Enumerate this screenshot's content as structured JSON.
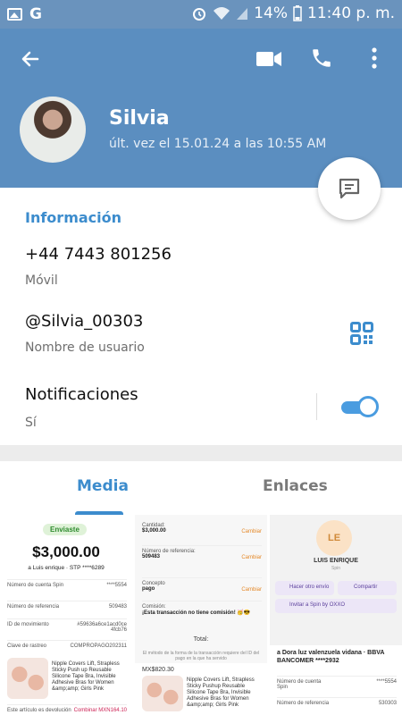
{
  "status_bar": {
    "battery": "14%",
    "time": "11:40 p. m."
  },
  "profile": {
    "name": "Silvia",
    "last_seen": "últ. vez el 15.01.24 a las 10:55 AM"
  },
  "info": {
    "section_title": "Información",
    "phone": "+44 7443 801256",
    "phone_label": "Móvil",
    "username": "@Silvia_00303",
    "username_label": "Nombre de usuario",
    "notifications_title": "Notificaciones",
    "notifications_value": "Sí"
  },
  "tabs": {
    "media": "Media",
    "links": "Enlaces"
  },
  "media": {
    "c1": {
      "badge": "Enviaste",
      "amount": "$3,000.00",
      "to": "a Luis enrique · STP ****6289",
      "rows": [
        {
          "k": "Número de cuenta Spin",
          "v": "****5554"
        },
        {
          "k": "Número de referencia",
          "v": "509483"
        },
        {
          "k": "ID de movimiento",
          "v": "#59636a6ce1acd0ce 4fcb76"
        },
        {
          "k": "Clave de rastreo",
          "v": "COMPROPAGO202311"
        }
      ],
      "ad_text": "Nipple Covers Lift, Strapless Sticky Push up Reusable Silicone Tape Bra, Invisible Adhesive Bras for Women &amp;amp; Girls Pink",
      "ad_footer_left": "Este artículo es devolución",
      "ad_footer_right": "Combinar MXN164.10"
    },
    "c2": {
      "rows": [
        {
          "k": "Cantidad:",
          "v2": "$3,000.00",
          "a": "Cambiar"
        },
        {
          "k": "Número de referencia:",
          "v2": "509483",
          "a": "Cambiar"
        },
        {
          "k": "Concepto",
          "v2": "pago",
          "a": "Cambiar"
        },
        {
          "k": "Comisión:",
          "v2": "¡Esta transacción no tiene comisión! 🥳😎",
          "a": ""
        }
      ],
      "total": "Total:",
      "note": "El método de la forma de la transacción requiere del ID del pago en la que ha servido",
      "price": "MX$820.30",
      "ad_text": "Nipple Covers Lift, Strapless Sticky Pushup Reusable Silicone Tape Bra, Invisible Adhesive Bras for Women &amp;amp; Girls Pink"
    },
    "c3": {
      "initials": "LE",
      "name": "LUIS ENRIQUE",
      "sub": "Spin",
      "btn1": "Hacer otro envío",
      "btn2": "Compartir",
      "btn3": "Invitar a Spin by OXXO",
      "dest": "a Dora luz valenzuela vidana · BBVA BANCOMER ****2932",
      "row1_k": "Número de cuenta Spin",
      "row1_v": "****5554",
      "row2_k": "Número de referencia",
      "row2_v": "530303"
    }
  },
  "colors": {
    "header": "#5b8ec0",
    "accent": "#3c8ccd",
    "status_bar": "#6a93bd"
  }
}
